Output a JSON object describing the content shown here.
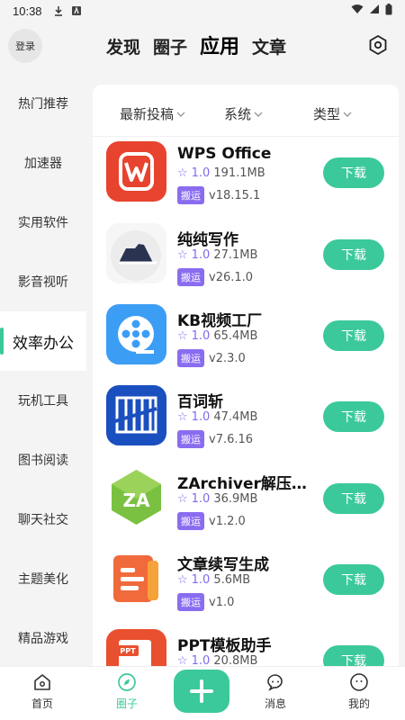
{
  "status": {
    "time": "10:38"
  },
  "header": {
    "login_label": "登录",
    "tabs": [
      {
        "label": "发现",
        "active": false
      },
      {
        "label": "圈子",
        "active": false
      },
      {
        "label": "应用",
        "active": true
      },
      {
        "label": "文章",
        "active": false
      }
    ]
  },
  "sidebar": {
    "items": [
      {
        "label": "热门推荐"
      },
      {
        "label": "加速器"
      },
      {
        "label": "实用软件"
      },
      {
        "label": "影音视听"
      },
      {
        "label": "效率办公",
        "active": true
      },
      {
        "label": "玩机工具"
      },
      {
        "label": "图书阅读"
      },
      {
        "label": "聊天社交"
      },
      {
        "label": "主题美化"
      },
      {
        "label": "精品游戏"
      }
    ]
  },
  "filters": {
    "sort": "最新投稿",
    "system": "系统",
    "type": "类型"
  },
  "apps": [
    {
      "name": "WPS Office",
      "rating": "1.0",
      "size": "191.1MB",
      "badge": "搬运",
      "version": "v18.15.1",
      "button": "下载"
    },
    {
      "name": "纯纯写作",
      "rating": "1.0",
      "size": "27.1MB",
      "badge": "搬运",
      "version": "v26.1.0",
      "button": "下载"
    },
    {
      "name": "KB视频工厂",
      "rating": "1.0",
      "size": "65.4MB",
      "badge": "搬运",
      "version": "v2.3.0",
      "button": "下载"
    },
    {
      "name": "百词斩",
      "rating": "1.0",
      "size": "47.4MB",
      "badge": "搬运",
      "version": "v7.6.16",
      "button": "下载"
    },
    {
      "name": "ZArchiver解压缩…",
      "rating": "1.0",
      "size": "36.9MB",
      "badge": "搬运",
      "version": "v1.2.0",
      "button": "下载"
    },
    {
      "name": "文章续写生成",
      "rating": "1.0",
      "size": "5.6MB",
      "badge": "搬运",
      "version": "v1.0",
      "button": "下载"
    },
    {
      "name": "PPT模板助手",
      "rating": "1.0",
      "size": "20.8MB",
      "badge": "",
      "version": "",
      "button": "下载"
    }
  ],
  "bottom_nav": {
    "home": "首页",
    "circle": "圈子",
    "messages": "消息",
    "mine": "我的"
  },
  "colors": {
    "accent": "#3bc99b",
    "badge": "#8a6cf0"
  }
}
